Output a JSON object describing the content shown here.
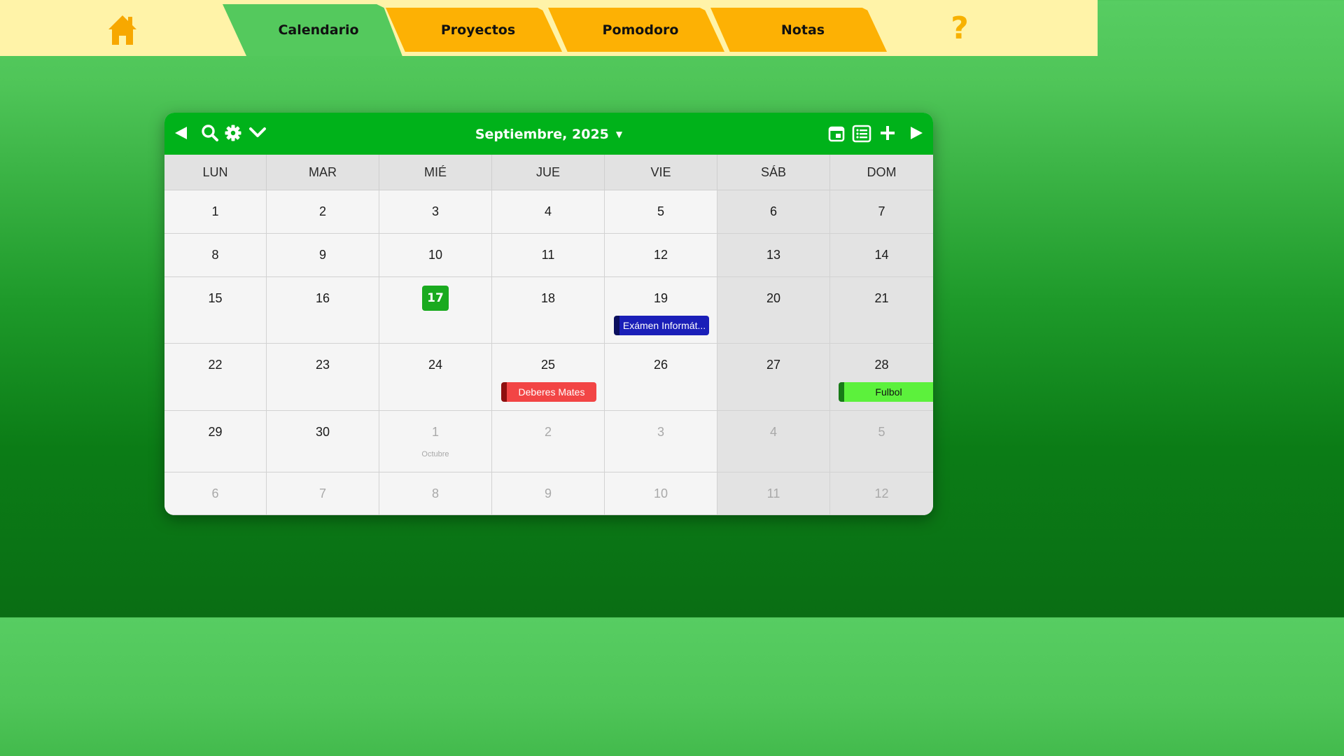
{
  "nav": {
    "tabs": [
      {
        "label": "Calendario",
        "active": true
      },
      {
        "label": "Proyectos",
        "active": false
      },
      {
        "label": "Pomodoro",
        "active": false
      },
      {
        "label": "Notas",
        "active": false
      }
    ],
    "home_icon": "home-icon",
    "help_label": "?"
  },
  "calendar": {
    "month_title": "Septiembre, 2025",
    "toolbar_icons": [
      "prev-arrow-icon",
      "search-icon",
      "gear-icon",
      "chevron-down-icon",
      "month-view-icon",
      "list-view-icon",
      "plus-icon",
      "next-arrow-icon"
    ],
    "weekdays": [
      "LUN",
      "MAR",
      "MIÉ",
      "JUE",
      "VIE",
      "SÁB",
      "DOM"
    ],
    "weeks": [
      [
        {
          "n": "1"
        },
        {
          "n": "2"
        },
        {
          "n": "3"
        },
        {
          "n": "4"
        },
        {
          "n": "5"
        },
        {
          "n": "6"
        },
        {
          "n": "7"
        }
      ],
      [
        {
          "n": "8"
        },
        {
          "n": "9"
        },
        {
          "n": "10"
        },
        {
          "n": "11"
        },
        {
          "n": "12"
        },
        {
          "n": "13"
        },
        {
          "n": "14"
        }
      ],
      [
        {
          "n": "15"
        },
        {
          "n": "16"
        },
        {
          "n": "17",
          "today": true
        },
        {
          "n": "18"
        },
        {
          "n": "19"
        },
        {
          "n": "20"
        },
        {
          "n": "21"
        }
      ],
      [
        {
          "n": "22"
        },
        {
          "n": "23"
        },
        {
          "n": "24"
        },
        {
          "n": "25"
        },
        {
          "n": "26"
        },
        {
          "n": "27"
        },
        {
          "n": "28"
        }
      ],
      [
        {
          "n": "29"
        },
        {
          "n": "30"
        },
        {
          "n": "1",
          "other": true,
          "month_label": "Octubre"
        },
        {
          "n": "2",
          "other": true
        },
        {
          "n": "3",
          "other": true
        },
        {
          "n": "4",
          "other": true
        },
        {
          "n": "5",
          "other": true
        }
      ],
      [
        {
          "n": "6",
          "other": true
        },
        {
          "n": "7",
          "other": true
        },
        {
          "n": "8",
          "other": true
        },
        {
          "n": "9",
          "other": true
        },
        {
          "n": "10",
          "other": true
        },
        {
          "n": "11",
          "other": true
        },
        {
          "n": "12",
          "other": true
        }
      ]
    ],
    "events": [
      {
        "week": 2,
        "day": 4,
        "title": "Exámen Informát...",
        "bg": "#1a1fb8",
        "border": "#0b0f5e",
        "text": "#ffffff"
      },
      {
        "week": 3,
        "day": 3,
        "title": "Deberes Mates",
        "bg": "#f24545",
        "border": "#8f1010",
        "text": "#ffffff"
      },
      {
        "week": 3,
        "day": 6,
        "title": "Fulbol",
        "bg": "#5cf13c",
        "border": "#187a17",
        "text": "#111111"
      }
    ]
  },
  "colors": {
    "accent_green": "#00b21a",
    "tab_orange": "#fdb104",
    "topbar_bg": "#fff3a8",
    "today_green": "#1aaa1f"
  }
}
